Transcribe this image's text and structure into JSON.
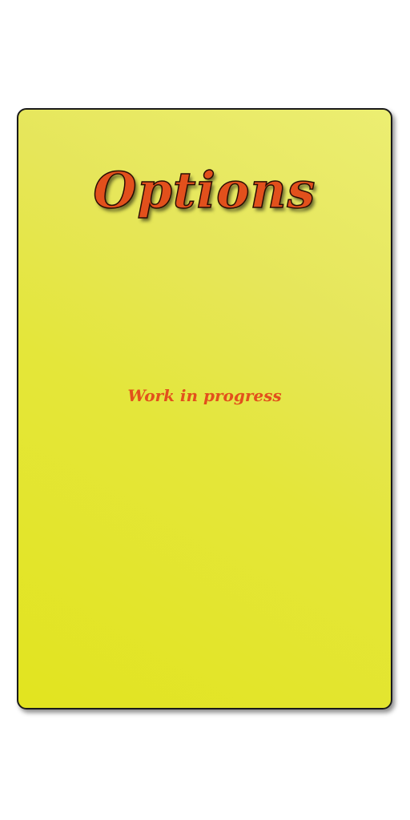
{
  "screen": {
    "title": "Options",
    "message": "Work in progress"
  },
  "colors": {
    "background": "#ffffff",
    "panel": "#e4e630",
    "panel_border": "#1a1a1a",
    "title_text": "#e2501c",
    "title_outline": "#2a0d04",
    "message_text": "#e2501c"
  }
}
